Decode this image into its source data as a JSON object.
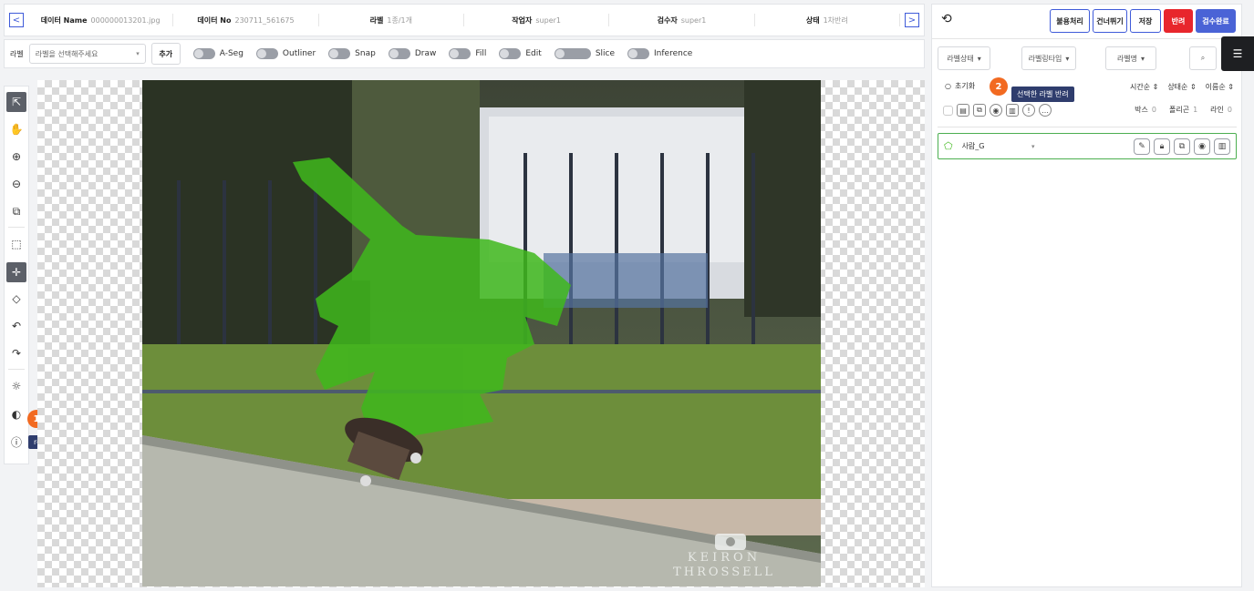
{
  "header": {
    "data_name_label": "데이터 Name",
    "data_name_value": "000000013201.jpg",
    "data_no_label": "데이터 No",
    "data_no_value": "230711_561675",
    "label_label": "라벨",
    "label_value": "1종/1개",
    "worker_label": "작업자",
    "worker_value": "super1",
    "inspector_label": "검수자",
    "inspector_value": "super1",
    "status_label": "상태",
    "status_value": "1차반려",
    "prev_icon": "<",
    "next_icon": ">"
  },
  "toolbar": {
    "label_text": "라벨",
    "label_select_placeholder": "라벨을 선택해주세요",
    "add_button": "추가",
    "toggles": [
      "A-Seg",
      "Outliner",
      "Snap",
      "Draw",
      "Fill",
      "Edit",
      "Slice",
      "Inference"
    ]
  },
  "left_tools": [
    "select-icon",
    "hand-icon",
    "zoom-in-icon",
    "zoom-out-icon",
    "copy-icon",
    "box-select-icon",
    "point-icon",
    "tag-icon",
    "undo-icon",
    "redo-icon",
    "brightness-icon",
    "contrast-icon",
    "reject-comment-icon"
  ],
  "annotations": {
    "badge1": "1",
    "tooltip1": "rejectComment",
    "badge2": "2",
    "tooltip2": "선택한 라벨 반려"
  },
  "watermark": {
    "line1": "KEIRON",
    "line2": "THROSSELL"
  },
  "right_panel": {
    "buttons": {
      "unusable": "불용처리",
      "skip": "건너뛰기",
      "save": "저장",
      "reject": "반려",
      "complete": "검수완료"
    },
    "filters": {
      "label_status": "라벨상태",
      "labeling_type": "라벨링타입",
      "label_name": "라벨명"
    },
    "reset": "초기화",
    "sort": {
      "time": "시간순",
      "status": "상태순",
      "name": "이름순"
    },
    "counts": {
      "box_label": "박스",
      "box_value": "0",
      "polygon_label": "폴리곤",
      "polygon_value": "1",
      "line_label": "라인",
      "line_value": "0"
    },
    "label_item": {
      "name": "사람_G"
    }
  },
  "colors": {
    "accent_blue": "#3f5bd9",
    "reject_red": "#e8262c",
    "badge_orange": "#f26a21",
    "tooltip_navy": "#2f3d6d",
    "mask_green": "#3fb81c"
  }
}
